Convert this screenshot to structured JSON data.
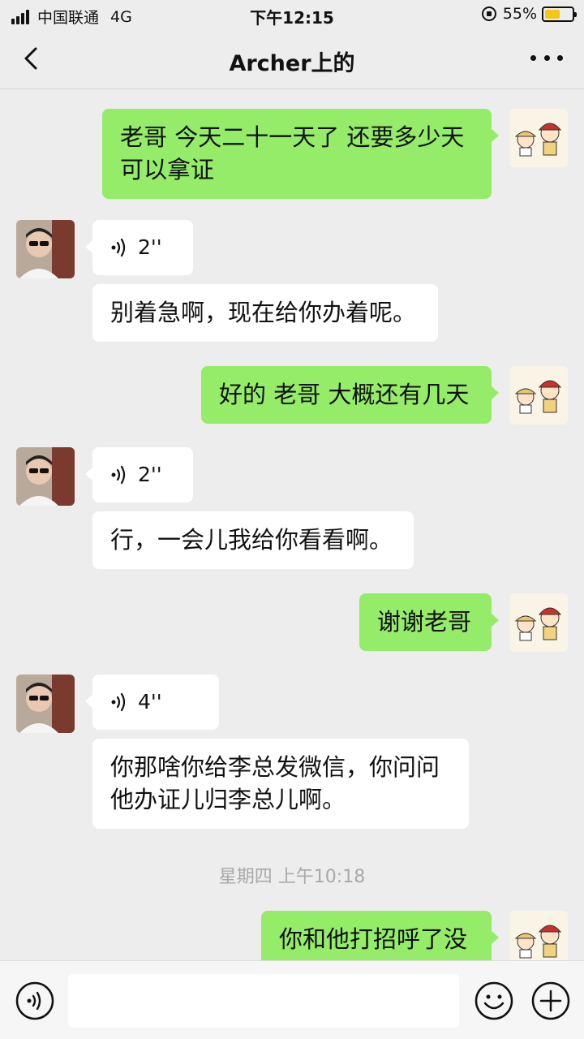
{
  "status": {
    "carrier": "中国联通",
    "network": "4G",
    "time": "下午12:15",
    "battery": "55%",
    "battery_level": 0.55
  },
  "nav": {
    "title": "Archer上的"
  },
  "messages": [
    {
      "side": "right",
      "type": "text",
      "lines": [
        "老哥 今天二十一天了 还要多少天",
        "可以拿证"
      ]
    },
    {
      "side": "left",
      "type": "voice",
      "duration": "2''"
    },
    {
      "side": "left",
      "type": "text",
      "lines": [
        "别着急啊，现在给你办着呢。"
      ]
    },
    {
      "side": "right",
      "type": "text",
      "lines": [
        "好的 老哥 大概还有几天"
      ]
    },
    {
      "side": "left",
      "type": "voice",
      "duration": "2''"
    },
    {
      "side": "left",
      "type": "text",
      "lines": [
        "行，一会儿我给你看看啊。"
      ]
    },
    {
      "side": "right",
      "type": "text",
      "lines": [
        "谢谢老哥"
      ]
    },
    {
      "side": "left",
      "type": "voice",
      "duration": "4''"
    },
    {
      "side": "left",
      "type": "text",
      "lines": [
        "你那啥你给李总发微信，你问问",
        "他办证儿归李总儿啊。"
      ]
    },
    {
      "side": "right",
      "type": "text",
      "lines": [
        "你和他打招呼了没"
      ]
    }
  ],
  "timestamp": "星期四 上午10:18",
  "input": {
    "placeholder": ""
  },
  "colors": {
    "background": "#ededed",
    "outgoing_bubble": "#95ec69",
    "incoming_bubble": "#ffffff",
    "timestamp_text": "#a9a9a9"
  },
  "icons": {
    "back": "chevron-left-icon",
    "more": "more-dots-icon",
    "voice_mode": "voice-mode-icon",
    "emoji": "emoji-icon",
    "add": "plus-icon",
    "voice_wave": "voice-wave-icon"
  }
}
